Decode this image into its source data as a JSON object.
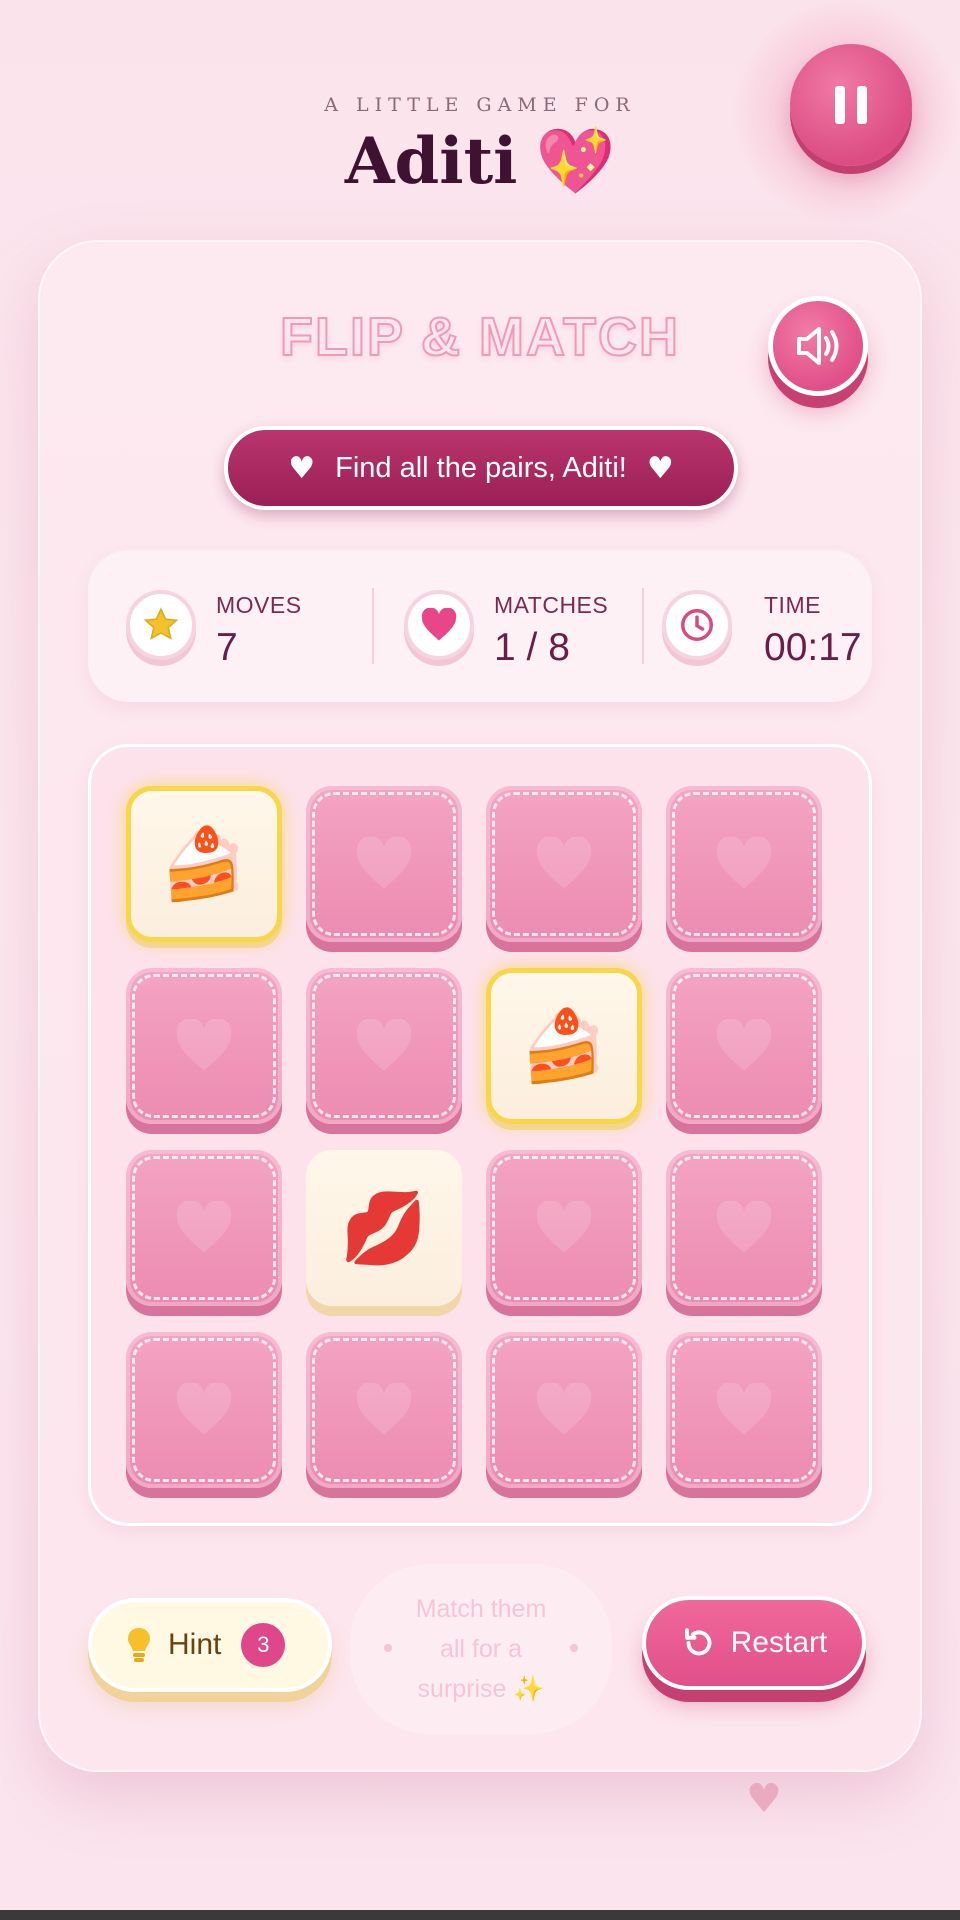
{
  "header": {
    "subtitle": "A LITTLE GAME FOR",
    "name": "Aditi",
    "heart_emoji": "💖"
  },
  "game": {
    "title": "FLIP & MATCH",
    "banner_text": "Find all the pairs, Aditi!"
  },
  "stats": {
    "moves_label": "MOVES",
    "moves_value": "7",
    "matches_label": "MATCHES",
    "matches_value": "1 / 8",
    "time_label": "TIME",
    "time_value": "00:17"
  },
  "tiles": [
    {
      "state": "face-up",
      "symbol": "🍰",
      "highlight": true
    },
    {
      "state": "face-down"
    },
    {
      "state": "face-down"
    },
    {
      "state": "face-down"
    },
    {
      "state": "face-down"
    },
    {
      "state": "face-down"
    },
    {
      "state": "face-up",
      "symbol": "🍰",
      "highlight": true
    },
    {
      "state": "face-down"
    },
    {
      "state": "face-down"
    },
    {
      "state": "face-up",
      "symbol": "💋",
      "highlight": false
    },
    {
      "state": "face-down"
    },
    {
      "state": "face-down"
    },
    {
      "state": "face-down"
    },
    {
      "state": "face-down"
    },
    {
      "state": "face-down"
    },
    {
      "state": "face-down"
    }
  ],
  "controls": {
    "hint_label": "Hint",
    "hint_count": "3",
    "note_text": "Match them all for a surprise ✨",
    "restart_label": "Restart"
  },
  "colors": {
    "accent": "#e0508a",
    "banner": "#a8265e",
    "tile_back": "#f09bbd",
    "highlight": "#f8d64a"
  }
}
